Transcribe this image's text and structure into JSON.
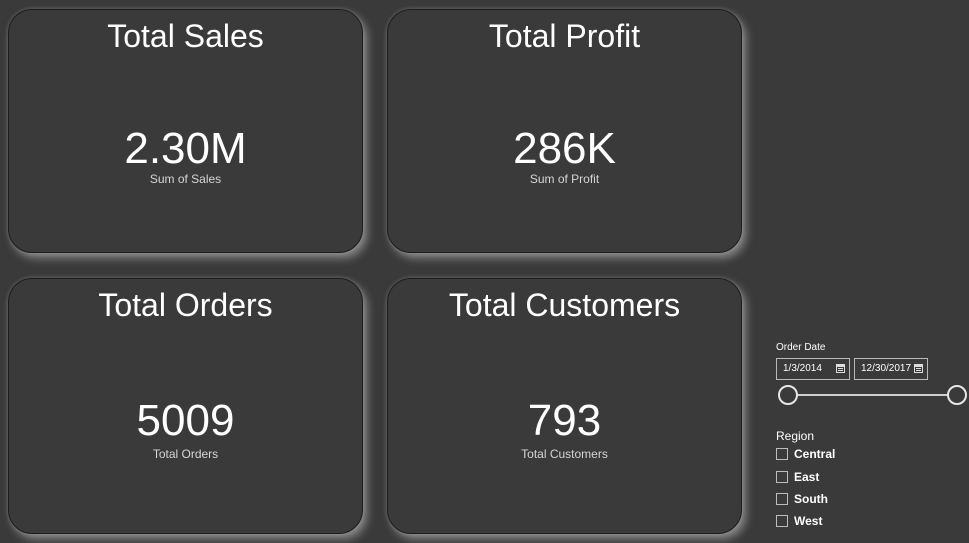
{
  "cards": {
    "sales": {
      "title": "Total Sales",
      "value": "2.30M",
      "caption": "Sum of Sales"
    },
    "profit": {
      "title": "Total Profit",
      "value": "286K",
      "caption": "Sum of Profit"
    },
    "orders": {
      "title": "Total Orders",
      "value": "5009",
      "caption": "Total Orders"
    },
    "customers": {
      "title": "Total Customers",
      "value": "793",
      "caption": "Total Customers"
    }
  },
  "order_date": {
    "label": "Order Date",
    "start": "1/3/2014",
    "end": "12/30/2017",
    "calendar_icon": "calendar-icon"
  },
  "region": {
    "title": "Region",
    "items": [
      {
        "label": "Central",
        "checked": false
      },
      {
        "label": "East",
        "checked": false
      },
      {
        "label": "South",
        "checked": false
      },
      {
        "label": "West",
        "checked": false
      }
    ]
  },
  "colors": {
    "background": "#3a3a3a",
    "text": "#ffffff",
    "card_border": "#1c1c1c"
  }
}
